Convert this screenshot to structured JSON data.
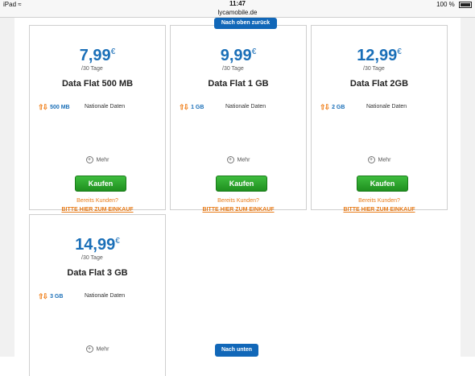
{
  "status_bar": {
    "device": "iPad",
    "time": "11:47",
    "battery": "100 %"
  },
  "browser": {
    "url": "lycamobile.de"
  },
  "navigation": {
    "scroll_top": "Nach oben zurück",
    "scroll_bottom": "Nach unten"
  },
  "currency_symbol": "€",
  "plans": [
    {
      "price": "7,99",
      "period": "/30 Tage",
      "name": "Data Flat 500 MB",
      "data_amount": "500 MB",
      "feature": "Nationale Daten",
      "more": "Mehr",
      "buy": "Kaufen",
      "existing_customer": "Bereits Kunden?",
      "login_link": "BITTE HIER ZUM EINKAUF"
    },
    {
      "price": "9,99",
      "period": "/30 Tage",
      "name": "Data Flat 1 GB",
      "data_amount": "1 GB",
      "feature": "Nationale Daten",
      "more": "Mehr",
      "buy": "Kaufen",
      "existing_customer": "Bereits Kunden?",
      "login_link": "BITTE HIER ZUM EINKAUF"
    },
    {
      "price": "12,99",
      "period": "/30 Tage",
      "name": "Data Flat 2GB",
      "data_amount": "2 GB",
      "feature": "Nationale Daten",
      "more": "Mehr",
      "buy": "Kaufen",
      "existing_customer": "Bereits Kunden?",
      "login_link": "BITTE HIER ZUM EINKAUF"
    },
    {
      "price": "14,99",
      "period": "/30 Tage",
      "name": "Data Flat 3 GB",
      "data_amount": "3 GB",
      "feature": "Nationale Daten",
      "more": "Mehr"
    }
  ],
  "icons": {
    "data_icon": "orange-up-down-arrows-icon",
    "more_icon": "plus-circle-icon",
    "wifi_icon": "wifi-icon",
    "battery_icon": "battery-icon"
  },
  "colors": {
    "price_blue": "#1a6fb8",
    "buy_green": "#2ea82e",
    "link_orange": "#e87b18",
    "nav_blue": "#1167b8"
  }
}
